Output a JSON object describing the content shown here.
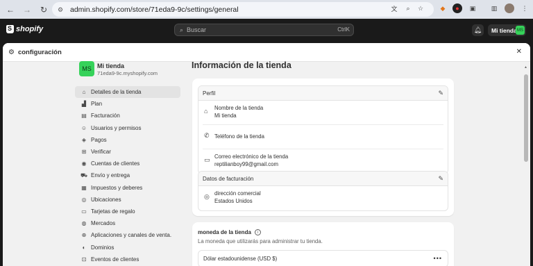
{
  "browser": {
    "url": "admin.shopify.com/store/71eda9-9c/settings/general",
    "back_icon": "←",
    "forward_icon": "→",
    "reload_icon": "↻"
  },
  "topbar": {
    "logo_text": "shopify",
    "search_placeholder": "Buscar",
    "search_shortcut": "CtrlK",
    "store_button_label": "Mi tienda",
    "store_avatar": "MS"
  },
  "modal": {
    "title": "configuración",
    "close_icon": "✕"
  },
  "sidebar": {
    "store_name": "Mi tienda",
    "store_url": "71eda9-9c.myshopify.com",
    "store_avatar": "MS",
    "items": [
      {
        "label": "Detalles de la tienda",
        "icon": "store-icon",
        "active": true
      },
      {
        "label": "Plan",
        "icon": "chart-icon",
        "active": false
      },
      {
        "label": "Facturación",
        "icon": "billing-icon",
        "active": false
      },
      {
        "label": "Usuarios y permisos",
        "icon": "users-icon",
        "active": false
      },
      {
        "label": "Pagos",
        "icon": "payments-icon",
        "active": false
      },
      {
        "label": "Verificar",
        "icon": "checkout-icon",
        "active": false
      },
      {
        "label": "Cuentas de clientes",
        "icon": "customer-accounts-icon",
        "active": false
      },
      {
        "label": "Envío y entrega",
        "icon": "truck-icon",
        "active": false
      },
      {
        "label": "Impuestos y deberes",
        "icon": "taxes-icon",
        "active": false
      },
      {
        "label": "Ubicaciones",
        "icon": "location-icon",
        "active": false
      },
      {
        "label": "Tarjetas de regalo",
        "icon": "gift-card-icon",
        "active": false
      },
      {
        "label": "Mercados",
        "icon": "globe-icon",
        "active": false
      },
      {
        "label": "Aplicaciones y canales de venta.",
        "icon": "apps-icon",
        "active": false
      },
      {
        "label": "Dominios",
        "icon": "domain-icon",
        "active": false
      },
      {
        "label": "Eventos de clientes",
        "icon": "events-icon",
        "active": false
      }
    ]
  },
  "main": {
    "title": "Información de la tienda",
    "profile": {
      "header": "Perfil",
      "store_name_label": "Nombre de la tienda",
      "store_name_value": "Mi tienda",
      "phone_label": "Teléfono de la tienda",
      "email_label": "Correo electrónico de la tienda",
      "email_value": "reptilianboy99@gmail.com"
    },
    "billing": {
      "header": "Datos de facturación",
      "address_label": "dirección comercial",
      "address_value": "Estados Unidos"
    },
    "currency": {
      "title": "moneda de la tienda",
      "subtitle": "La moneda que utilizarás para administrar tu tienda.",
      "value": "Dólar estadounidense (USD $)"
    }
  }
}
